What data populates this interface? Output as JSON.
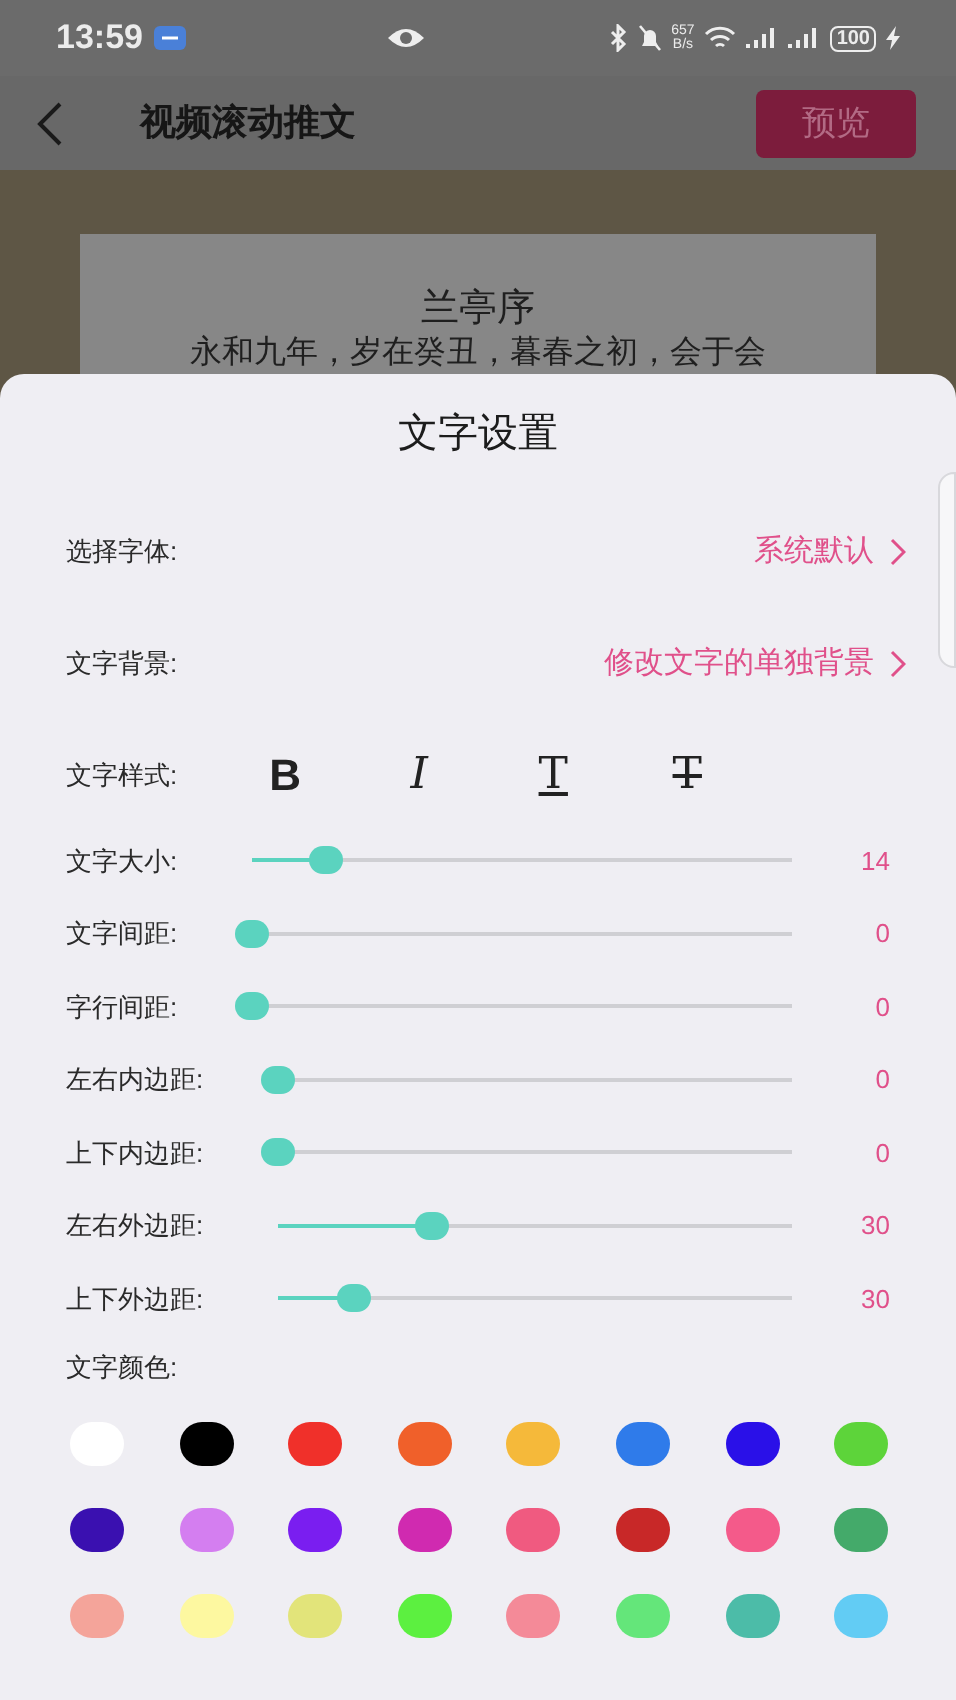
{
  "status_bar": {
    "time": "13:59",
    "network_speed": {
      "value": "657",
      "unit": "B/s"
    },
    "battery": "100"
  },
  "header": {
    "title": "视频滚动推文",
    "preview_button": "预览"
  },
  "preview": {
    "title": "兰亭序",
    "text": "永和九年，岁在癸丑，暮春之初，会于会"
  },
  "sheet": {
    "title": "文字设置",
    "options": [
      {
        "label": "选择字体:",
        "value": "系统默认"
      },
      {
        "label": "文字背景:",
        "value": "修改文字的单独背景"
      }
    ],
    "style_label": "文字样式:",
    "style_buttons": [
      {
        "kind": "bold",
        "glyph": "B"
      },
      {
        "kind": "italic",
        "glyph": "I"
      },
      {
        "kind": "underline",
        "glyph": "T"
      },
      {
        "kind": "strikethrough",
        "glyph": "T"
      }
    ],
    "sliders": [
      {
        "label": "文字大小:",
        "level": 0.14,
        "reading": "14"
      },
      {
        "label": "文字间距:",
        "level": 0,
        "reading": "0"
      },
      {
        "label": "字行间距:",
        "level": 0,
        "reading": "0"
      },
      {
        "label": "左右内边距:",
        "level": 0,
        "reading": "0"
      },
      {
        "label": "上下内边距:",
        "level": 0,
        "reading": "0"
      },
      {
        "label": "左右外边距:",
        "level": 0.3,
        "reading": "30"
      },
      {
        "label": "上下外边距:",
        "level": 0.15,
        "reading": "30"
      }
    ],
    "color_label": "文字颜色:",
    "colors": [
      {
        "color": "#ffffff"
      },
      {
        "color": "#000000"
      },
      {
        "color": "#f0302a"
      },
      {
        "color": "#f0602a"
      },
      {
        "color": "#f5b93a"
      },
      {
        "color": "#2f7bea"
      },
      {
        "color": "#2a10e8"
      },
      {
        "color": "#5dd43a"
      },
      {
        "color": "#3a10b0"
      },
      {
        "color": "#d47ef0"
      },
      {
        "color": "#7a1ef0"
      },
      {
        "color": "#d02ab0"
      },
      {
        "color": "#f05a80"
      },
      {
        "color": "#c82828"
      },
      {
        "color": "#f45a8a"
      },
      {
        "color": "#44aa6a"
      },
      {
        "color": "#f4a49a"
      },
      {
        "color": "#fdf8a0"
      },
      {
        "color": "#e2e47a"
      },
      {
        "color": "#5cf040"
      },
      {
        "color": "#f48a98"
      },
      {
        "color": "#64e67a"
      },
      {
        "color": "#4cbca8"
      },
      {
        "color": "#62ccf4"
      }
    ]
  }
}
